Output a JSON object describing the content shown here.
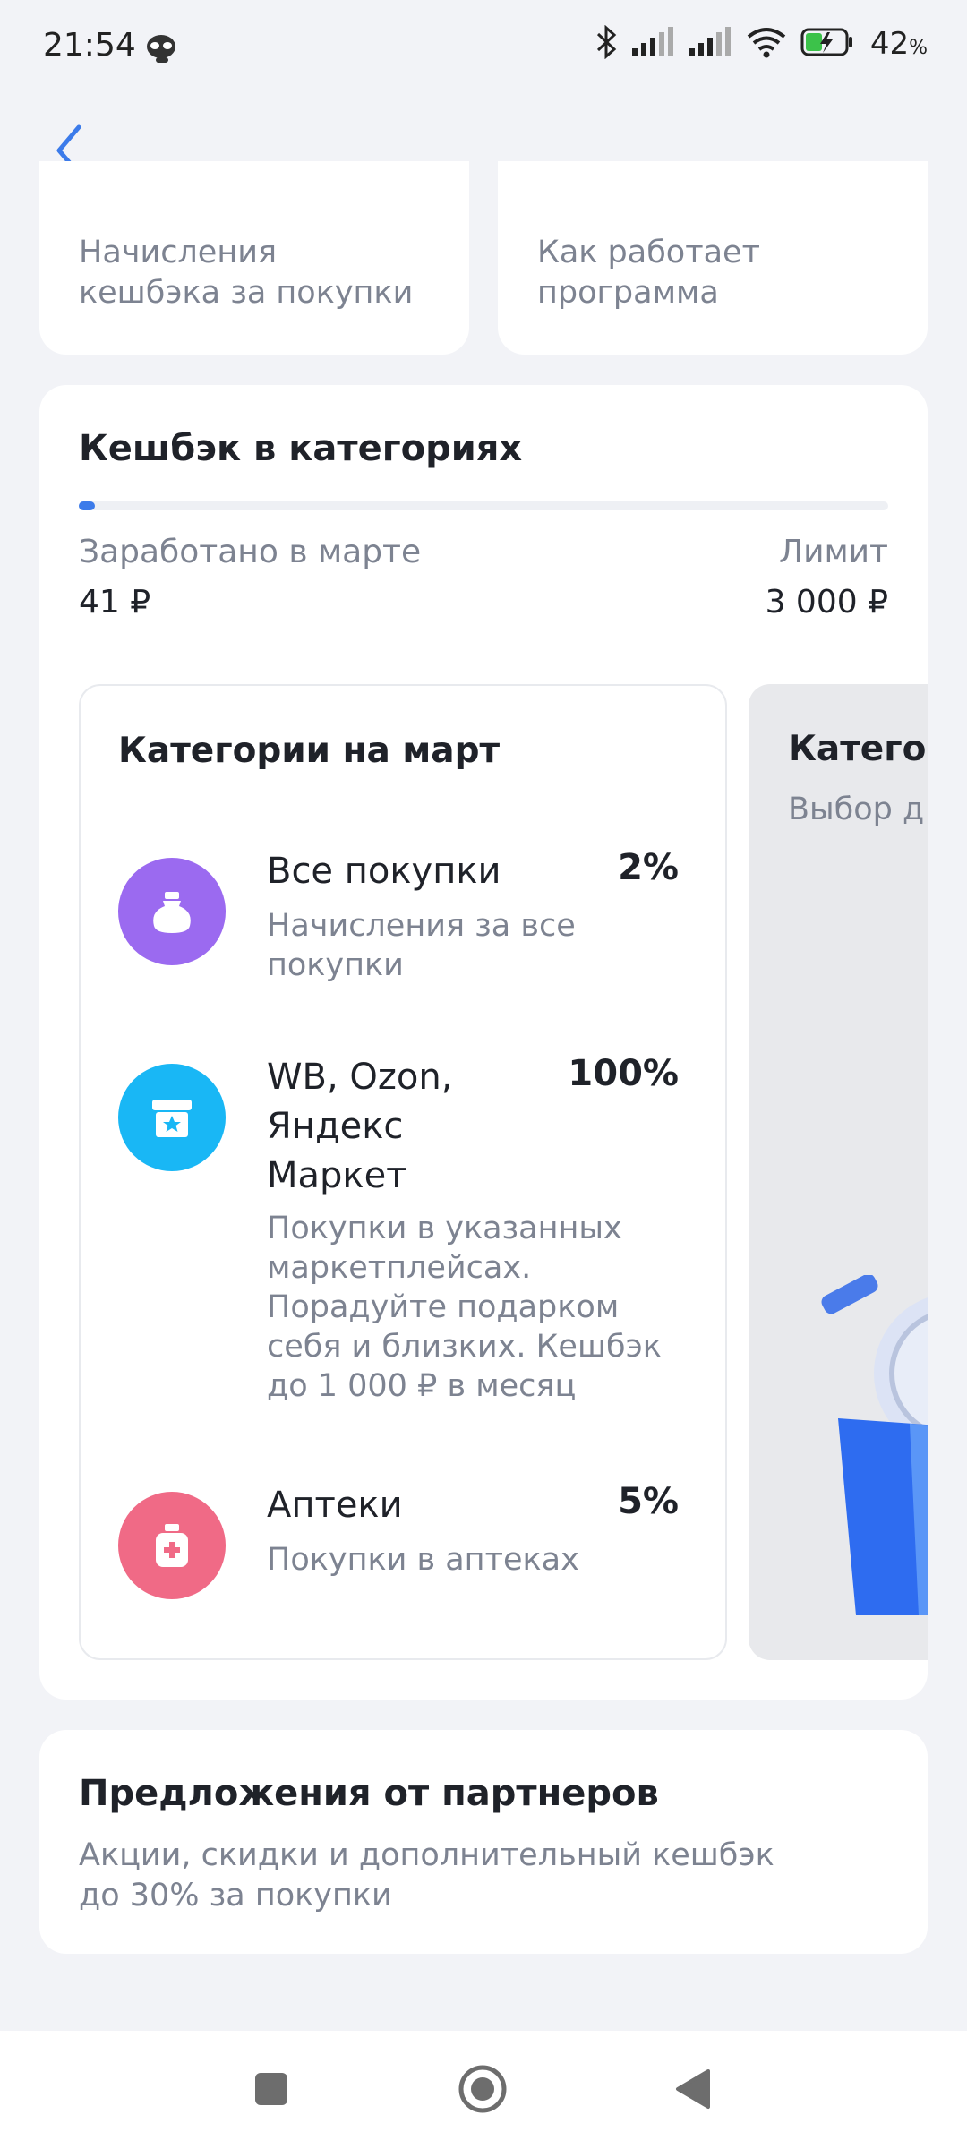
{
  "status_bar": {
    "time": "21:54",
    "battery_percent": "42",
    "battery_unit": "%",
    "icons": [
      "alien-icon",
      "bluetooth-icon",
      "signal-icon",
      "signal-icon",
      "wifi-icon",
      "battery-charging-icon"
    ]
  },
  "header": {
    "back_icon": "chevron-left-icon"
  },
  "top_cards": [
    {
      "label": "Начисления\nкешбэка за покупки"
    },
    {
      "label": "Как работает\nпрограмма"
    }
  ],
  "cashback": {
    "title": "Кешбэк в категориях",
    "progress_fraction": 0.0137,
    "earned_label": "Заработано в марте",
    "earned_value": "41 ₽",
    "limit_label": "Лимит",
    "limit_value": "3 000 ₽",
    "categories_panel": {
      "title": "Категории на март",
      "items": [
        {
          "name": "Все покупки",
          "percent": "2%",
          "desc": "Начисления за все\nпокупки",
          "icon": "bag-icon",
          "color": "#9B6AF0"
        },
        {
          "name": "WB, Ozon,\nЯндекс\nМаркет",
          "percent": "100%",
          "desc": "Покупки в указанных\nмаркетплейсах.\nПорадуйте подарком\nсебя и близких. Кешбэк\nдо 1 000 ₽ в месяц",
          "icon": "gift-box-icon",
          "color": "#19B7F5"
        },
        {
          "name": "Аптеки",
          "percent": "5%",
          "desc": "Покупки в аптеках",
          "icon": "medicine-icon",
          "color": "#F06A86"
        }
      ]
    },
    "next_panel": {
      "title": "Категор",
      "subtitle": "Выбор д"
    }
  },
  "partners": {
    "title": "Предложения от партнеров",
    "desc": "Акции, скидки и дополнительный кешбэк\nдо 30% за покупки"
  },
  "nav_bar": {
    "icons": [
      "recents-square-icon",
      "home-circle-icon",
      "back-triangle-icon"
    ]
  },
  "colors": {
    "accent": "#3C7BEA",
    "background": "#F2F3F7",
    "muted_text": "#7D8391"
  }
}
